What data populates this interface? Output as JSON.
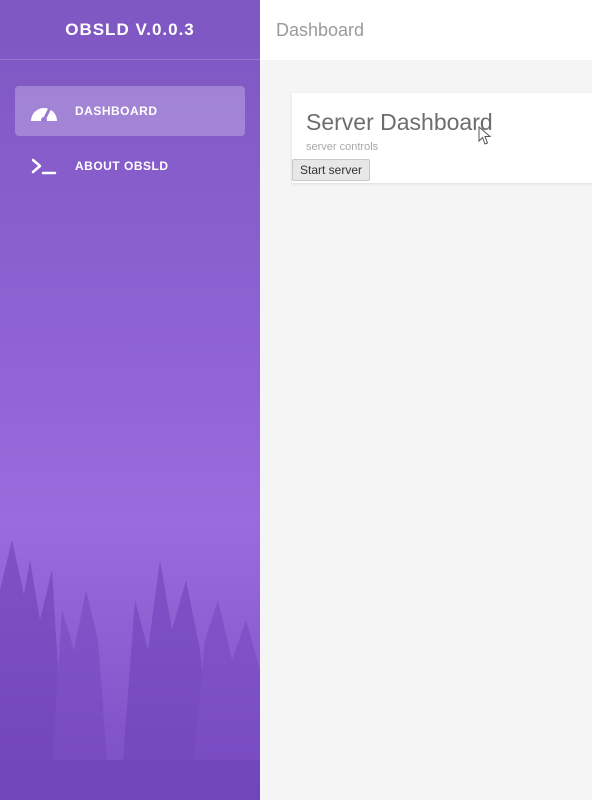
{
  "sidebar": {
    "brand": "OBSLD V.0.0.3",
    "items": [
      {
        "label": "DASHBOARD",
        "icon": "dashboard-icon",
        "active": true
      },
      {
        "label": "ABOUT OBSLD",
        "icon": "terminal-icon",
        "active": false
      }
    ]
  },
  "header": {
    "title": "Dashboard"
  },
  "main": {
    "card": {
      "title": "Server Dashboard",
      "subtitle": "server controls",
      "button_label": "Start server"
    }
  },
  "colors": {
    "sidebar_top": "#7e57c2",
    "sidebar_mid": "#9a6bdc",
    "content_bg": "#f5f5f5"
  }
}
